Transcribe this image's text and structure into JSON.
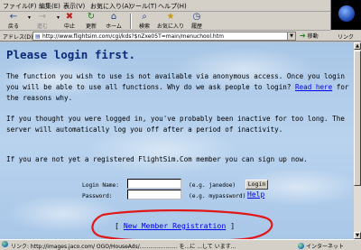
{
  "menu": [
    "ファイル(F)",
    "編集(E)",
    "表示(V)",
    "お気に入り(A)",
    "ツール(T)",
    "ヘルプ(H)"
  ],
  "toolbar": {
    "back": "戻る",
    "forward": "進む",
    "stop": "中止",
    "refresh": "更新",
    "home": "ホーム",
    "search": "検索",
    "favorites": "お気に入り",
    "history": "履歴"
  },
  "address": {
    "label": "アドレス(D)",
    "url": "http://www.flightsim.com/cgi/kds?$nZxe05T=main/menuchool.htm",
    "go": "移動",
    "links": "リンク"
  },
  "page": {
    "title": "Please login first.",
    "para1": "The function you wish to use is not available via anonymous access. Once you login you will be able to use all functions. Why do we ask people to login? ",
    "para1_link": "Read here",
    "para1_tail": " for the reasons why.",
    "para2": "If you thought you were logged in, you've probably been inactive for too long. The server will automatically log you off after a period of inactivity.",
    "para3": "If you are not yet a registered FlightSim.Com member you can sign up now."
  },
  "form": {
    "login_label": "Login Name:",
    "login_value": "",
    "login_hint": "(e.g. janedoe)",
    "password_label": "Password:",
    "password_value": "",
    "password_hint": "(e.g. mypassword)",
    "login_button": "Login",
    "help_link": "Help"
  },
  "register": {
    "open": "[",
    "link": "New Member Registration",
    "close": "]"
  },
  "status": {
    "text": "リンク: http://images.jaco.com/ OGO/HouseAds/...................... を...に ...して います...",
    "zone": "インターネット"
  }
}
